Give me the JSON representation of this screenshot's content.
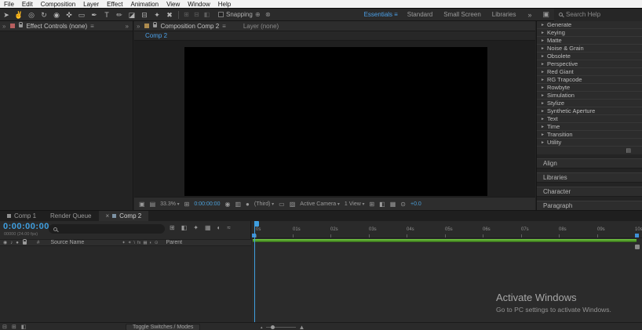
{
  "menu": {
    "items": [
      "File",
      "Edit",
      "Composition",
      "Layer",
      "Effect",
      "Animation",
      "View",
      "Window",
      "Help"
    ]
  },
  "toolbar": {
    "tool_glyphs": [
      "➤",
      "✌",
      "◎",
      "↻",
      "◉",
      "✜",
      "▭",
      "✒",
      "T",
      "✏",
      "◪",
      "⊟",
      "✦",
      "✖"
    ],
    "dim_icon_glyphs": [
      "⊞",
      "⊟",
      "◧"
    ],
    "snapping_label": "Snapping",
    "snap_option_glyphs": [
      "⊕",
      "⊗"
    ],
    "workspaces": [
      "Essentials",
      "Standard",
      "Small Screen",
      "Libraries"
    ],
    "workspace_menu_icon": "≡",
    "workspace_overflow": "»",
    "workspace_panel_icon": "▣",
    "search_placeholder": "Search Help"
  },
  "effect_controls": {
    "overflow_left": "»",
    "title": "Effect Controls (none)",
    "menu_icon": "≡",
    "overflow_right": "»"
  },
  "composition": {
    "overflow_left": "»",
    "title": "Composition Comp 2",
    "menu_icon": "≡",
    "layer_tab": "Layer (none)",
    "viewer_tab": "Comp 2",
    "bar": {
      "icon_glyphs": [
        "▣",
        "▤",
        "⊞",
        "◉",
        "▥",
        "●",
        "▭",
        "▨",
        "⊞",
        "◧",
        "▦",
        "⊙"
      ],
      "zoom": "33.3%",
      "timecode": "0:00:00:00",
      "resolution": "(Third)",
      "camera": "Active Camera",
      "view": "1 View",
      "exposure": "+0.0"
    }
  },
  "effects_panel": {
    "categories": [
      "Generate",
      "Keying",
      "Matte",
      "Noise & Grain",
      "Obsolete",
      "Perspective",
      "Red Giant",
      "RG Trapcode",
      "Rowbyte",
      "Simulation",
      "Stylize",
      "Synthetic Aperture",
      "Text",
      "Time",
      "Transition",
      "Utility"
    ],
    "footer_icon": "▤"
  },
  "collapsed_panels": {
    "titles": [
      "Align",
      "Libraries",
      "Character",
      "Paragraph"
    ]
  },
  "timeline": {
    "tabs": [
      "Comp 1",
      "Render Queue",
      "Comp 2"
    ],
    "close_icon": "×",
    "timecode": "0:00:00:00",
    "frame_info": "00000 (24.00 fps)",
    "panel_icon_glyphs": [
      "⊞",
      "◧",
      "✦",
      "▦",
      "◐",
      "≈"
    ],
    "header": {
      "eye": "◉",
      "audio": "♪",
      "solo": "●",
      "number": "#",
      "source_name": "Source Name",
      "switch_glyphs": [
        "✦",
        "✶",
        "\\",
        "fx",
        "▦",
        "◐",
        "⊙"
      ],
      "parent": "Parent"
    },
    "ruler_ticks": [
      "0s",
      "01s",
      "02s",
      "03s",
      "04s",
      "05s",
      "06s",
      "07s",
      "08s",
      "09s",
      "10s"
    ],
    "toggle_label": "Toggle Switches / Modes",
    "bottom_icon_glyphs": [
      "⊟",
      "⊞",
      "◧"
    ],
    "zoom_out_glyph": "▴",
    "zoom_in_glyph": "▲"
  },
  "watermark": {
    "line1": "Activate Windows",
    "line2": "Go to PC settings to activate Windows."
  }
}
